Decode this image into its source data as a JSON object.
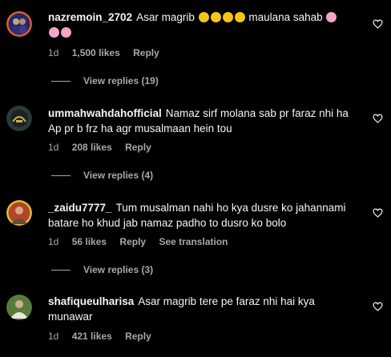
{
  "comments": [
    {
      "username": "nazremoin_2702",
      "text_a": "Asar magrib",
      "text_b": "maulana sahab",
      "time": "1d",
      "likes": "1,500 likes",
      "reply_label": "Reply",
      "view_replies": "View replies (19)"
    },
    {
      "username": "ummahwahdahofficial",
      "text": "Namaz sirf molana sab pr faraz nhi ha Ap pr b frz ha agr musalmaan hein tou",
      "time": "1d",
      "likes": "208 likes",
      "reply_label": "Reply",
      "view_replies": "View replies (4)"
    },
    {
      "username": "_zaidu7777_",
      "text": "Tum musalman nahi ho kya dusre ko jahannami batare ho khud jab namaz padho to dusro ko bolo",
      "time": "1d",
      "likes": "56 likes",
      "reply_label": "Reply",
      "translation_label": "See translation",
      "view_replies": "View replies (3)"
    },
    {
      "username": "shafiqueulharisa",
      "text": "Asar magrib tere pe faraz nhi hai kya munawar",
      "time": "1d",
      "likes": "421 likes",
      "reply_label": "Reply"
    }
  ],
  "icons": {
    "heart": "heart-outline-icon",
    "emoji_laugh": "rolling-laughing-emoji",
    "emoji_squint": "squinting-laughing-emoji"
  },
  "colors": {
    "background": "#000000",
    "text": "#f5f5f5",
    "secondary": "#a8a8a8"
  }
}
